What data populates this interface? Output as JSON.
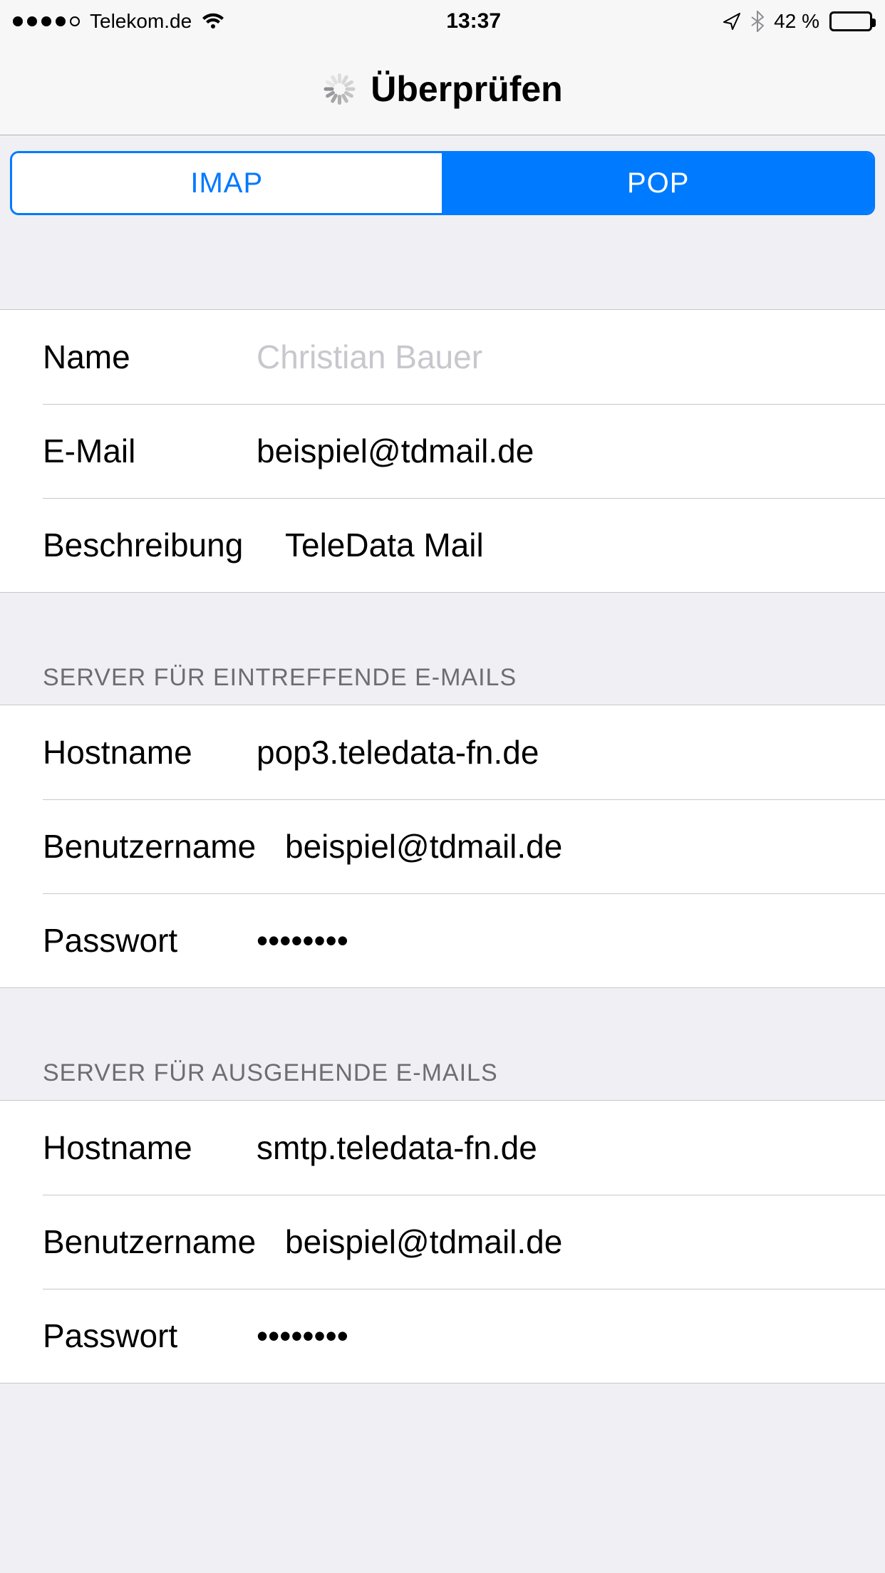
{
  "status": {
    "carrier": "Telekom.de",
    "time": "13:37",
    "battery_text": "42 %"
  },
  "nav": {
    "title": "Überprüfen"
  },
  "segmented": {
    "imap": "IMAP",
    "pop": "POP",
    "selected": "POP"
  },
  "account": {
    "name_label": "Name",
    "name_placeholder": "Christian Bauer",
    "name_value": "",
    "email_label": "E-Mail",
    "email_value": "beispiel@tdmail.de",
    "desc_label": "Beschreibung",
    "desc_value": "TeleData Mail"
  },
  "incoming": {
    "header": "SERVER FÜR EINTREFFENDE E-MAILS",
    "host_label": "Hostname",
    "host_value": "pop3.teledata-fn.de",
    "user_label": "Benutzername",
    "user_value": "beispiel@tdmail.de",
    "pass_label": "Passwort",
    "pass_value": "••••••••"
  },
  "outgoing": {
    "header": "SERVER FÜR AUSGEHENDE E-MAILS",
    "host_label": "Hostname",
    "host_value": "smtp.teledata-fn.de",
    "user_label": "Benutzername",
    "user_value": "beispiel@tdmail.de",
    "pass_label": "Passwort",
    "pass_value": "••••••••"
  }
}
